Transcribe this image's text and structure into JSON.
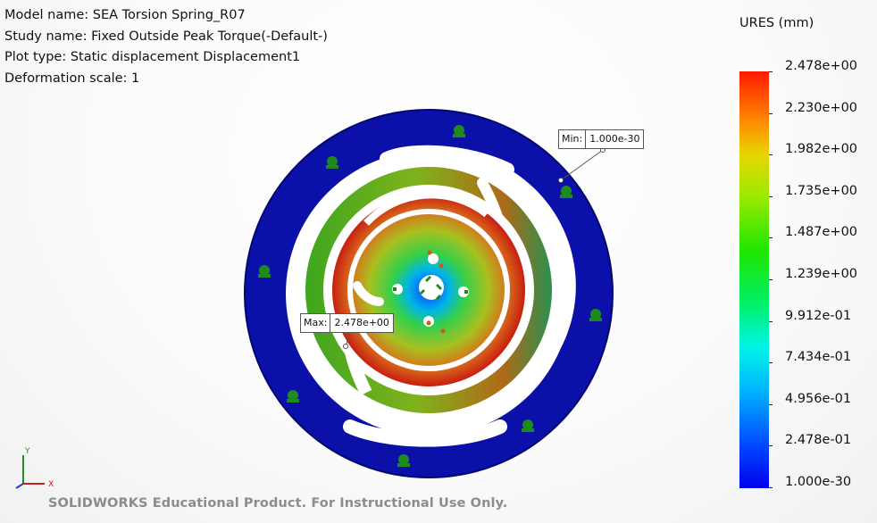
{
  "info": {
    "model_name": "Model name: SEA Torsion Spring_R07",
    "study_name": "Study name: Fixed Outside Peak Torque(-Default-)",
    "plot_type": "Plot type: Static displacement Displacement1",
    "deformation_scale": "Deformation scale: 1"
  },
  "legend": {
    "title": "URES (mm)",
    "labels": [
      "2.478e+00",
      "2.230e+00",
      "1.982e+00",
      "1.735e+00",
      "1.487e+00",
      "1.239e+00",
      "9.912e-01",
      "7.434e-01",
      "4.956e-01",
      "2.478e-01",
      "1.000e-30"
    ],
    "color_top": "#ff1a00",
    "color_bottom": "#0000ee"
  },
  "probes": {
    "min_key": "Min:",
    "min_value": "1.000e-30",
    "max_key": "Max:",
    "max_value": "2.478e+00"
  },
  "triad": {
    "x": "X",
    "y": "Y"
  },
  "watermark": "SOLIDWORKS Educational Product. For Instructional Use Only.",
  "icons": [
    "fixture-icon",
    "load-icon",
    "triad-icon"
  ]
}
